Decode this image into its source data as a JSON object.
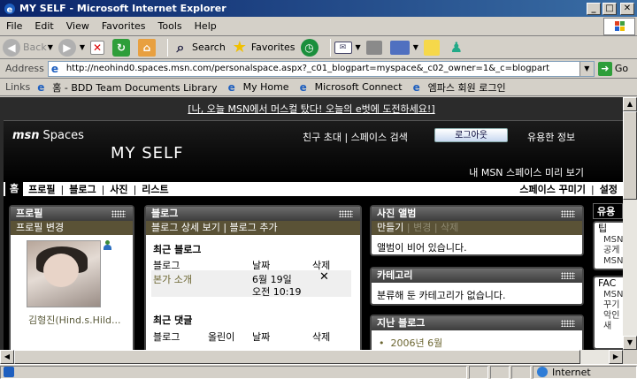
{
  "window": {
    "title": "MY SELF - Microsoft Internet Explorer",
    "min": "_",
    "max": "□",
    "close": "✕"
  },
  "menu": [
    "File",
    "Edit",
    "View",
    "Favorites",
    "Tools",
    "Help"
  ],
  "toolbar": {
    "back": "Back",
    "search": "Search",
    "favorites": "Favorites"
  },
  "address": {
    "label": "Address",
    "url": "http://neohind0.spaces.msn.com/personalspace.aspx?_c01_blogpart=myspace&_c02_owner=1&_c=blogpart",
    "go": "Go"
  },
  "links": {
    "label": "Links",
    "items": [
      "홈 - BDD Team Documents Library",
      "My Home",
      "Microsoft Connect",
      "엠파스 회원 로그인"
    ]
  },
  "page": {
    "promo": "[나, 오늘 MSN에서 머스컬 탔다! 오늘의 e벗에 도전하세요!]",
    "msn": "msn",
    "spaces": "Spaces",
    "header_links": "친구 초대 | 스페이스 검색",
    "logout": "로그아웃",
    "help": "유용한 정보",
    "space_title": "MY SELF",
    "preview": "내 MSN 스페이스 미리 보기",
    "nav": {
      "home": "홈",
      "profile": "프로필",
      "blog": "블로그",
      "photos": "사진",
      "lists": "리스트",
      "customize": "스페이스 꾸미기",
      "settings": "설정"
    },
    "profile_panel": {
      "title": "프로필",
      "edit": "프로필 변경",
      "name": "김형진(Hind.s.Hild..."
    },
    "blog_panel": {
      "title": "블로그",
      "actions": "블로그 상세 보기 | 블로그 추가",
      "recent_blog": "최근 블로그",
      "col_blog": "블로그",
      "col_date": "날짜",
      "col_delete": "삭제",
      "row_title": "본가 소개",
      "row_date": "6월 19일",
      "row_time": "오전 10:19",
      "row_delete": "✕",
      "recent_comments": "최근 댓글",
      "col_author": "올린이"
    },
    "album_panel": {
      "title": "사진 앨범",
      "action_create": "만들기",
      "action_change": "변경",
      "action_delete": "삭제",
      "empty": "앨범이 비어 있습니다."
    },
    "category_panel": {
      "title": "카테고리",
      "empty": "분류해 둔 카테고리가 없습니다."
    },
    "archive_panel": {
      "title": "지난 블로그",
      "item": "2006년 6월"
    },
    "far_right": {
      "tab": "유용",
      "head1": "팁",
      "lines1": [
        "MSN",
        "공게",
        "MSN"
      ],
      "head2": "FAC",
      "lines2": [
        "MSN",
        "꾸기",
        "악인",
        "새 "
      ]
    }
  },
  "status": {
    "zone": "Internet"
  }
}
